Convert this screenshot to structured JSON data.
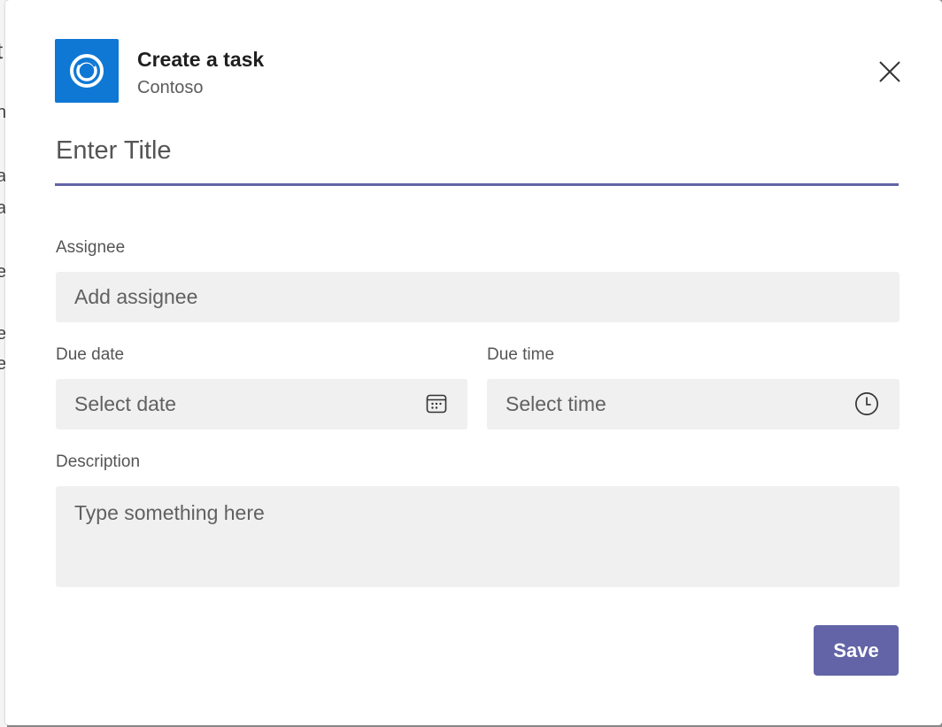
{
  "header": {
    "title": "Create a task",
    "subtitle": "Contoso",
    "logo_icon": "contoso-ring-logo",
    "close_icon": "close-icon",
    "brand_color": "#0f78d4"
  },
  "form": {
    "title_placeholder": "Enter Title",
    "assignee_label": "Assignee",
    "assignee_placeholder": "Add assignee",
    "due_date_label": "Due date",
    "due_date_placeholder": "Select date",
    "due_time_label": "Due time",
    "due_time_placeholder": "Select time",
    "description_label": "Description",
    "description_placeholder": "Type something here",
    "accent_color": "#6264a7"
  },
  "footer": {
    "save_label": "Save"
  },
  "background": {
    "fragments": [
      "t",
      "h",
      "a",
      "a",
      "e",
      "e",
      "e"
    ]
  }
}
